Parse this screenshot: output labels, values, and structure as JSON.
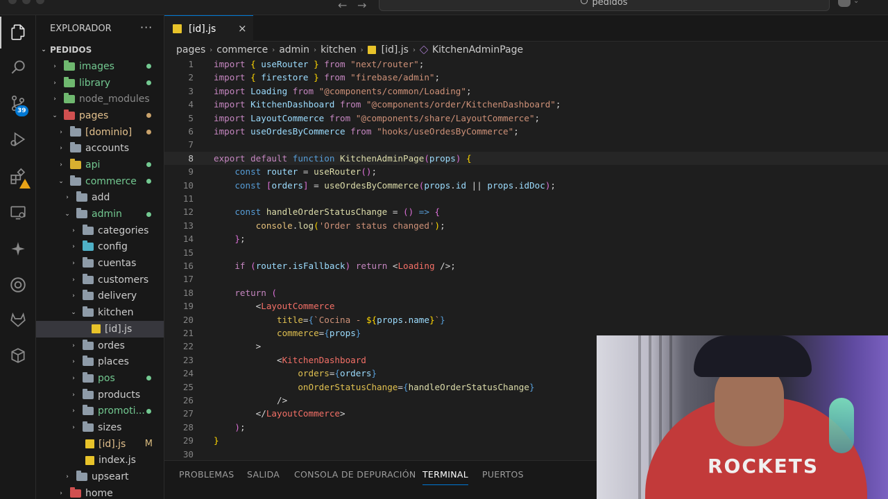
{
  "titlebar": {
    "search_text": "pedidos"
  },
  "activity": {
    "source_control_badge": "39"
  },
  "sidebar": {
    "title": "EXPLORADOR",
    "more": "···",
    "root": "PEDIDOS",
    "items": [
      {
        "name": "images",
        "chev": "›",
        "indent": 0,
        "color": "#73c991",
        "dot": "#73c991",
        "icon": "folder-green"
      },
      {
        "name": "library",
        "chev": "›",
        "indent": 0,
        "color": "#73c991",
        "dot": "#73c991",
        "icon": "folder-green"
      },
      {
        "name": "node_modules",
        "chev": "›",
        "indent": 0,
        "color": "#8b8b8b",
        "dot": "",
        "icon": "folder-green"
      },
      {
        "name": "pages",
        "chev": "⌄",
        "indent": 0,
        "color": "#e2c08d",
        "dot": "#c9a26b",
        "icon": "folder-red"
      },
      {
        "name": "[dominio]",
        "chev": "›",
        "indent": 1,
        "color": "#e2c08d",
        "dot": "#c9a26b",
        "icon": "folder"
      },
      {
        "name": "accounts",
        "chev": "›",
        "indent": 1,
        "color": "#cccccc",
        "dot": "",
        "icon": "folder"
      },
      {
        "name": "api",
        "chev": "›",
        "indent": 1,
        "color": "#73c991",
        "dot": "#73c991",
        "icon": "folder-yellow"
      },
      {
        "name": "commerce",
        "chev": "⌄",
        "indent": 1,
        "color": "#73c991",
        "dot": "#73c991",
        "icon": "folder"
      },
      {
        "name": "add",
        "chev": "›",
        "indent": 2,
        "color": "#cccccc",
        "dot": "",
        "icon": "folder"
      },
      {
        "name": "admin",
        "chev": "⌄",
        "indent": 2,
        "color": "#73c991",
        "dot": "#73c991",
        "icon": "folder"
      },
      {
        "name": "categories",
        "chev": "›",
        "indent": 3,
        "color": "#cccccc",
        "dot": "",
        "icon": "folder"
      },
      {
        "name": "config",
        "chev": "›",
        "indent": 3,
        "color": "#cccccc",
        "dot": "",
        "icon": "folder-config"
      },
      {
        "name": "cuentas",
        "chev": "›",
        "indent": 3,
        "color": "#cccccc",
        "dot": "",
        "icon": "folder"
      },
      {
        "name": "customers",
        "chev": "›",
        "indent": 3,
        "color": "#cccccc",
        "dot": "",
        "icon": "folder"
      },
      {
        "name": "delivery",
        "chev": "›",
        "indent": 3,
        "color": "#cccccc",
        "dot": "",
        "icon": "folder"
      },
      {
        "name": "kitchen",
        "chev": "⌄",
        "indent": 3,
        "color": "#cccccc",
        "dot": "",
        "icon": "folder"
      },
      {
        "name": "[id].js",
        "chev": "",
        "indent": 4,
        "color": "#cccccc",
        "dot": "",
        "icon": "js",
        "selected": true
      },
      {
        "name": "ordes",
        "chev": "›",
        "indent": 3,
        "color": "#cccccc",
        "dot": "",
        "icon": "folder"
      },
      {
        "name": "places",
        "chev": "›",
        "indent": 3,
        "color": "#cccccc",
        "dot": "",
        "icon": "folder"
      },
      {
        "name": "pos",
        "chev": "›",
        "indent": 3,
        "color": "#73c991",
        "dot": "#73c991",
        "icon": "folder"
      },
      {
        "name": "products",
        "chev": "›",
        "indent": 3,
        "color": "#cccccc",
        "dot": "",
        "icon": "folder"
      },
      {
        "name": "promoti...",
        "chev": "›",
        "indent": 3,
        "color": "#73c991",
        "dot": "#73c991",
        "icon": "folder"
      },
      {
        "name": "sizes",
        "chev": "›",
        "indent": 3,
        "color": "#cccccc",
        "dot": "",
        "icon": "folder"
      },
      {
        "name": "[id].js",
        "chev": "",
        "indent": 3,
        "color": "#e2c08d",
        "dot": "",
        "mark": "M",
        "icon": "js"
      },
      {
        "name": "index.js",
        "chev": "",
        "indent": 3,
        "color": "#cccccc",
        "dot": "",
        "icon": "js"
      },
      {
        "name": "upseart",
        "chev": "›",
        "indent": 2,
        "color": "#cccccc",
        "dot": "",
        "icon": "folder"
      },
      {
        "name": "home",
        "chev": "›",
        "indent": 1,
        "color": "#cccccc",
        "dot": "",
        "icon": "folder-red"
      }
    ]
  },
  "tab": {
    "label": "[id].js",
    "close": "×"
  },
  "breadcrumb": [
    "pages",
    "commerce",
    "admin",
    "kitchen",
    "[id].js",
    "KitchenAdminPage"
  ],
  "editor": {
    "current_line": 8,
    "lines": [
      [
        [
          "kw",
          "import "
        ],
        [
          "brace",
          "{ "
        ],
        [
          "var",
          "useRouter"
        ],
        [
          "brace",
          " }"
        ],
        [
          "kw",
          " from "
        ],
        [
          "str",
          "\"next/router\""
        ],
        [
          "plain",
          ";"
        ]
      ],
      [
        [
          "kw",
          "import "
        ],
        [
          "brace",
          "{ "
        ],
        [
          "var",
          "firestore"
        ],
        [
          "brace",
          " }"
        ],
        [
          "kw",
          " from "
        ],
        [
          "str",
          "\"firebase/admin\""
        ],
        [
          "plain",
          ";"
        ]
      ],
      [
        [
          "kw",
          "import "
        ],
        [
          "var",
          "Loading"
        ],
        [
          "kw",
          " from "
        ],
        [
          "str",
          "\"@components/common/Loading\""
        ],
        [
          "plain",
          ";"
        ]
      ],
      [
        [
          "kw",
          "import "
        ],
        [
          "var",
          "KitchenDashboard"
        ],
        [
          "kw",
          " from "
        ],
        [
          "str",
          "\"@components/order/KitchenDashboard\""
        ],
        [
          "plain",
          ";"
        ]
      ],
      [
        [
          "kw",
          "import "
        ],
        [
          "var",
          "LayoutCommerce"
        ],
        [
          "kw",
          " from "
        ],
        [
          "str",
          "\"@components/share/LayoutCommerce\""
        ],
        [
          "plain",
          ";"
        ]
      ],
      [
        [
          "kw",
          "import "
        ],
        [
          "var",
          "useOrdesByCommerce"
        ],
        [
          "kw",
          " from "
        ],
        [
          "str",
          "\"hooks/useOrdesByCommerce\""
        ],
        [
          "plain",
          ";"
        ]
      ],
      [],
      [
        [
          "kw",
          "export "
        ],
        [
          "kw",
          "default "
        ],
        [
          "kw2",
          "function "
        ],
        [
          "fn",
          "KitchenAdminPage"
        ],
        [
          "brace2",
          "("
        ],
        [
          "var",
          "props"
        ],
        [
          "brace2",
          ")"
        ],
        [
          "plain",
          " "
        ],
        [
          "brace",
          "{"
        ]
      ],
      [
        [
          "plain",
          "    "
        ],
        [
          "kw2",
          "const "
        ],
        [
          "var",
          "router"
        ],
        [
          "plain",
          " = "
        ],
        [
          "fn",
          "useRouter"
        ],
        [
          "brace2",
          "()"
        ],
        [
          "plain",
          ";"
        ]
      ],
      [
        [
          "plain",
          "    "
        ],
        [
          "kw2",
          "const "
        ],
        [
          "brace2",
          "["
        ],
        [
          "var",
          "orders"
        ],
        [
          "brace2",
          "]"
        ],
        [
          "plain",
          " = "
        ],
        [
          "fn",
          "useOrdesByCommerce"
        ],
        [
          "brace2",
          "("
        ],
        [
          "var",
          "props"
        ],
        [
          "plain",
          "."
        ],
        [
          "var",
          "id"
        ],
        [
          "plain",
          " || "
        ],
        [
          "var",
          "props"
        ],
        [
          "plain",
          "."
        ],
        [
          "var",
          "idDoc"
        ],
        [
          "brace2",
          ")"
        ],
        [
          "plain",
          ";"
        ]
      ],
      [],
      [
        [
          "plain",
          "    "
        ],
        [
          "kw2",
          "const "
        ],
        [
          "fn",
          "handleOrderStatusChange"
        ],
        [
          "plain",
          " = "
        ],
        [
          "brace2",
          "()"
        ],
        [
          "kw2",
          " => "
        ],
        [
          "brace2",
          "{"
        ]
      ],
      [
        [
          "plain",
          "        "
        ],
        [
          "obj",
          "console"
        ],
        [
          "plain",
          "."
        ],
        [
          "fn",
          "log"
        ],
        [
          "brace",
          "("
        ],
        [
          "str",
          "'Order status changed'"
        ],
        [
          "brace",
          ")"
        ],
        [
          "plain",
          ";"
        ]
      ],
      [
        [
          "plain",
          "    "
        ],
        [
          "brace2",
          "}"
        ],
        [
          "plain",
          ";"
        ]
      ],
      [],
      [
        [
          "plain",
          "    "
        ],
        [
          "kw",
          "if "
        ],
        [
          "brace2",
          "("
        ],
        [
          "var",
          "router"
        ],
        [
          "plain",
          "."
        ],
        [
          "var",
          "isFallback"
        ],
        [
          "brace2",
          ")"
        ],
        [
          "kw",
          " return "
        ],
        [
          "plain",
          "<"
        ],
        [
          "tagname",
          "Loading"
        ],
        [
          "plain",
          " />;"
        ]
      ],
      [],
      [
        [
          "plain",
          "    "
        ],
        [
          "kw",
          "return "
        ],
        [
          "brace2",
          "("
        ]
      ],
      [
        [
          "plain",
          "        <"
        ],
        [
          "tagname",
          "LayoutCommerce"
        ]
      ],
      [
        [
          "plain",
          "            "
        ],
        [
          "attr",
          "title"
        ],
        [
          "plain",
          "="
        ],
        [
          "kw2",
          "{"
        ],
        [
          "str",
          "`Cocina - "
        ],
        [
          "brace",
          "${"
        ],
        [
          "var",
          "props"
        ],
        [
          "plain",
          "."
        ],
        [
          "var",
          "name"
        ],
        [
          "brace",
          "}"
        ],
        [
          "str",
          "`"
        ],
        [
          "kw2",
          "}"
        ]
      ],
      [
        [
          "plain",
          "            "
        ],
        [
          "attr",
          "commerce"
        ],
        [
          "plain",
          "="
        ],
        [
          "kw2",
          "{"
        ],
        [
          "var",
          "props"
        ],
        [
          "kw2",
          "}"
        ]
      ],
      [
        [
          "plain",
          "        >"
        ]
      ],
      [
        [
          "plain",
          "            <"
        ],
        [
          "tagname",
          "KitchenDashboard"
        ]
      ],
      [
        [
          "plain",
          "                "
        ],
        [
          "attr",
          "orders"
        ],
        [
          "plain",
          "="
        ],
        [
          "kw2",
          "{"
        ],
        [
          "var",
          "orders"
        ],
        [
          "kw2",
          "}"
        ]
      ],
      [
        [
          "plain",
          "                "
        ],
        [
          "attr",
          "onOrderStatusChange"
        ],
        [
          "plain",
          "="
        ],
        [
          "kw2",
          "{"
        ],
        [
          "fn",
          "handleOrderStatusChange"
        ],
        [
          "kw2",
          "}"
        ]
      ],
      [
        [
          "plain",
          "            />"
        ]
      ],
      [
        [
          "plain",
          "        </"
        ],
        [
          "tagname",
          "LayoutCommerce"
        ],
        [
          "plain",
          ">"
        ]
      ],
      [
        [
          "plain",
          "    "
        ],
        [
          "brace2",
          ")"
        ],
        [
          "plain",
          ";"
        ]
      ],
      [
        [
          "brace",
          "}"
        ]
      ],
      []
    ]
  },
  "panel": {
    "tabs": [
      "PROBLEMAS",
      "SALIDA",
      "CONSOLA DE DEPURACIÓN",
      "TERMINAL",
      "PUERTOS"
    ],
    "active": "TERMINAL"
  },
  "webcam": {
    "shirt_text": "ROCKETS"
  }
}
